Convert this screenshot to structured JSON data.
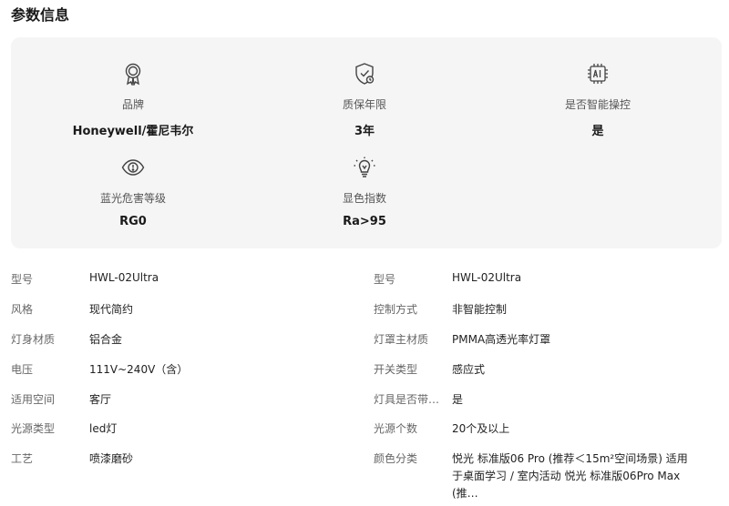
{
  "section_title": "参数信息",
  "highlights": [
    {
      "icon": "award-ribbon-icon",
      "label": "品牌",
      "value": "Honeywell/霍尼韦尔"
    },
    {
      "icon": "shield-check-icon",
      "label": "质保年限",
      "value": "3年"
    },
    {
      "icon": "ai-chip-icon",
      "label": "是否智能操控",
      "value": "是"
    },
    {
      "icon": "eye-warning-icon",
      "label": "蓝光危害等级",
      "value": "RG0"
    },
    {
      "icon": "lightbulb-icon",
      "label": "显色指数",
      "value": "Ra>95"
    }
  ],
  "specs_left": [
    {
      "key": "型号",
      "value": "HWL-02Ultra"
    },
    {
      "key": "风格",
      "value": "现代简约"
    },
    {
      "key": "灯身材质",
      "value": "铝合金"
    },
    {
      "key": "电压",
      "value": "111V~240V（含）"
    },
    {
      "key": "适用空间",
      "value": "客厅"
    },
    {
      "key": "光源类型",
      "value": "led灯"
    },
    {
      "key": "工艺",
      "value": "喷漆磨砂"
    }
  ],
  "specs_right": [
    {
      "key": "型号",
      "value": "HWL-02Ultra"
    },
    {
      "key": "控制方式",
      "value": "非智能控制"
    },
    {
      "key": "灯罩主材质",
      "value": "PMMA高透光率灯罩"
    },
    {
      "key": "开关类型",
      "value": "感应式"
    },
    {
      "key": "灯具是否带…",
      "value": "是"
    },
    {
      "key": "光源个数",
      "value": "20个及以上"
    },
    {
      "key": "颜色分类",
      "value": "悦光 标准版06 Pro (推荐＜15m²空间场景) 适用于桌面学习 / 室内活动 悦光 标准版06Pro Max (推…"
    }
  ]
}
